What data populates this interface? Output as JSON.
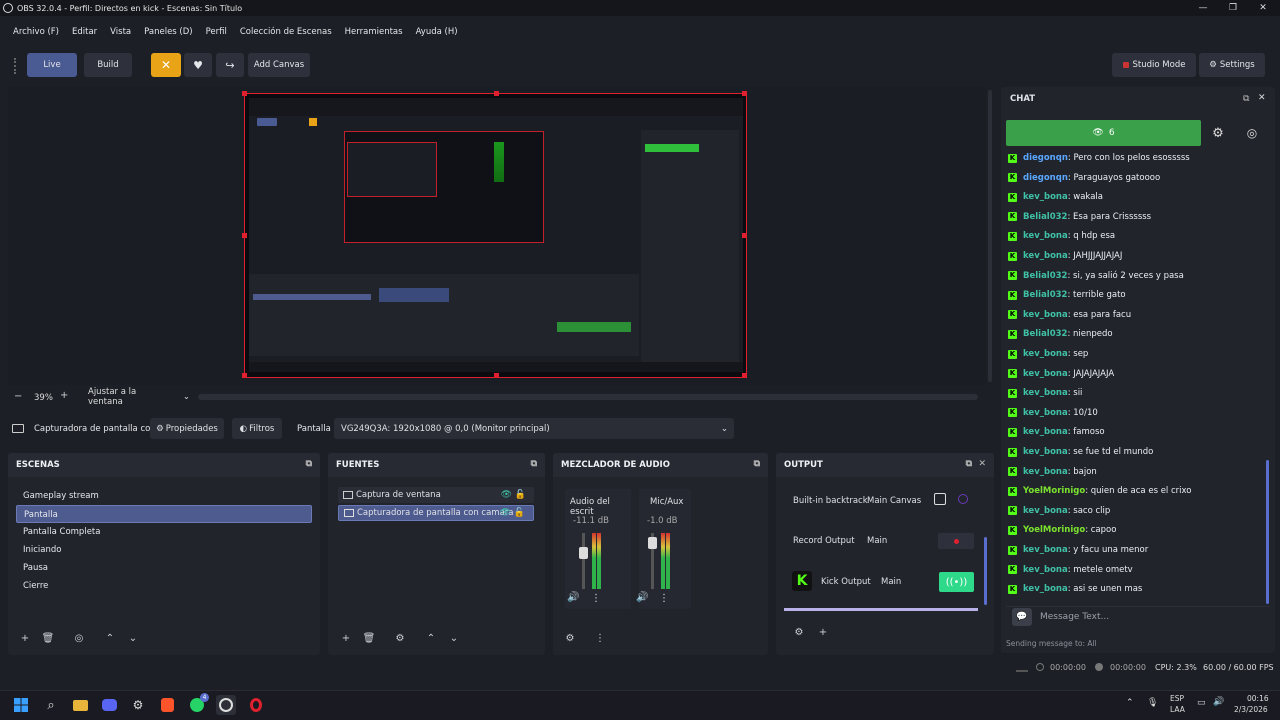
{
  "window": {
    "title": "OBS 32.0.4 - Perfil: Directos en kick - Escenas: Sin Título"
  },
  "menu": [
    "Archivo (F)",
    "Editar",
    "Vista",
    "Paneles (D)",
    "Perfil",
    "Colección de Escenas",
    "Herramientas",
    "Ayuda (H)"
  ],
  "toolbar": {
    "live": "Live",
    "build": "Build",
    "add_canvas": "Add Canvas",
    "studio_mode": "Studio Mode",
    "settings": "Settings"
  },
  "preview": {
    "zoom": "39%",
    "fit": "Ajustar a la ventana"
  },
  "source_bar": {
    "source": "Capturadora de pantalla con",
    "properties": "Propiedades",
    "filters": "Filtros",
    "display_label": "Pantalla",
    "display_value": "VG249Q3A: 1920x1080 @ 0,0 (Monitor principal)"
  },
  "scenes": {
    "title": "ESCENAS",
    "items": [
      "Gameplay stream",
      "Pantalla",
      "Pantalla Completa",
      "Iniciando",
      "Pausa",
      "Cierre"
    ],
    "selected": 1
  },
  "sources": {
    "title": "FUENTES",
    "items": [
      "Captura de ventana",
      "Capturadora de pantalla con camara"
    ]
  },
  "mixer": {
    "title": "MEZCLADOR DE AUDIO",
    "channels": [
      {
        "name": "Audio del escrit",
        "db": "-11.1 dB",
        "level": 0.55
      },
      {
        "name": "Mic/Aux",
        "db": "-1.0 dB",
        "level": 0.8
      }
    ]
  },
  "output": {
    "title": "OUTPUT",
    "rows": [
      {
        "name": "Built-in backtrack",
        "target": "Main Canvas"
      },
      {
        "name": "Record Output",
        "target": "Main"
      },
      {
        "name": "Kick Output",
        "target": "Main"
      }
    ]
  },
  "chat": {
    "title": "CHAT",
    "viewers": "6",
    "placeholder": "Message Text...",
    "sending": "Sending message to: All",
    "messages": [
      {
        "user": "diegonqn",
        "color": "#5aa7ff",
        "text": ": Pero con los pelos esosssss"
      },
      {
        "user": "diegonqn",
        "color": "#5aa7ff",
        "text": ": Paraguayos gatoooo"
      },
      {
        "user": "kev_bona",
        "color": "#3fc1a6",
        "text": ": wakala"
      },
      {
        "user": "Belial032",
        "color": "#3fc1a6",
        "text": ": Esa para Crissssss"
      },
      {
        "user": "kev_bona",
        "color": "#3fc1a6",
        "text": ": q hdp esa"
      },
      {
        "user": "kev_bona",
        "color": "#3fc1a6",
        "text": ": JAHJJJAJJAJAJ"
      },
      {
        "user": "Belial032",
        "color": "#3fc1a6",
        "text": ": si, ya salió 2 veces y pasa"
      },
      {
        "user": "Belial032",
        "color": "#3fc1a6",
        "text": ": terrible gato"
      },
      {
        "user": "kev_bona",
        "color": "#3fc1a6",
        "text": ": esa para facu"
      },
      {
        "user": "Belial032",
        "color": "#3fc1a6",
        "text": ": nienpedo"
      },
      {
        "user": "kev_bona",
        "color": "#3fc1a6",
        "text": ": sep"
      },
      {
        "user": "kev_bona",
        "color": "#3fc1a6",
        "text": ": JAJAJAJAJA"
      },
      {
        "user": "kev_bona",
        "color": "#3fc1a6",
        "text": ": sii"
      },
      {
        "user": "kev_bona",
        "color": "#3fc1a6",
        "text": ": 10/10"
      },
      {
        "user": "kev_bona",
        "color": "#3fc1a6",
        "text": ": famoso"
      },
      {
        "user": "kev_bona",
        "color": "#3fc1a6",
        "text": ": se fue td el mundo"
      },
      {
        "user": "kev_bona",
        "color": "#3fc1a6",
        "text": ": bajon"
      },
      {
        "user": "YoelMorinigo",
        "color": "#7be32e",
        "text": ": quien de aca es el crixo"
      },
      {
        "user": "kev_bona",
        "color": "#3fc1a6",
        "text": ": saco clip"
      },
      {
        "user": "YoelMorinigo",
        "color": "#7be32e",
        "text": ": capoo"
      },
      {
        "user": "kev_bona",
        "color": "#3fc1a6",
        "text": ": y facu una menor"
      },
      {
        "user": "kev_bona",
        "color": "#3fc1a6",
        "text": ": metele ometv"
      },
      {
        "user": "kev_bona",
        "color": "#3fc1a6",
        "text": ": asi se unen mas"
      }
    ]
  },
  "status": {
    "stream_time": "00:00:00",
    "rec_time": "00:00:00",
    "cpu": "CPU: 2.3%",
    "fps": "60.00 / 60.00 FPS"
  },
  "taskbar": {
    "lang1": "ESP",
    "lang2": "LAA",
    "time": "00:16",
    "date": "2/3/2026",
    "badge": "4"
  },
  "colors": {
    "accent": "#53fc18",
    "selection": "#4e5b8f",
    "live_btn": "#4a5a93",
    "tool_orange": "#e8a317",
    "preview_border": "#e0202e"
  }
}
